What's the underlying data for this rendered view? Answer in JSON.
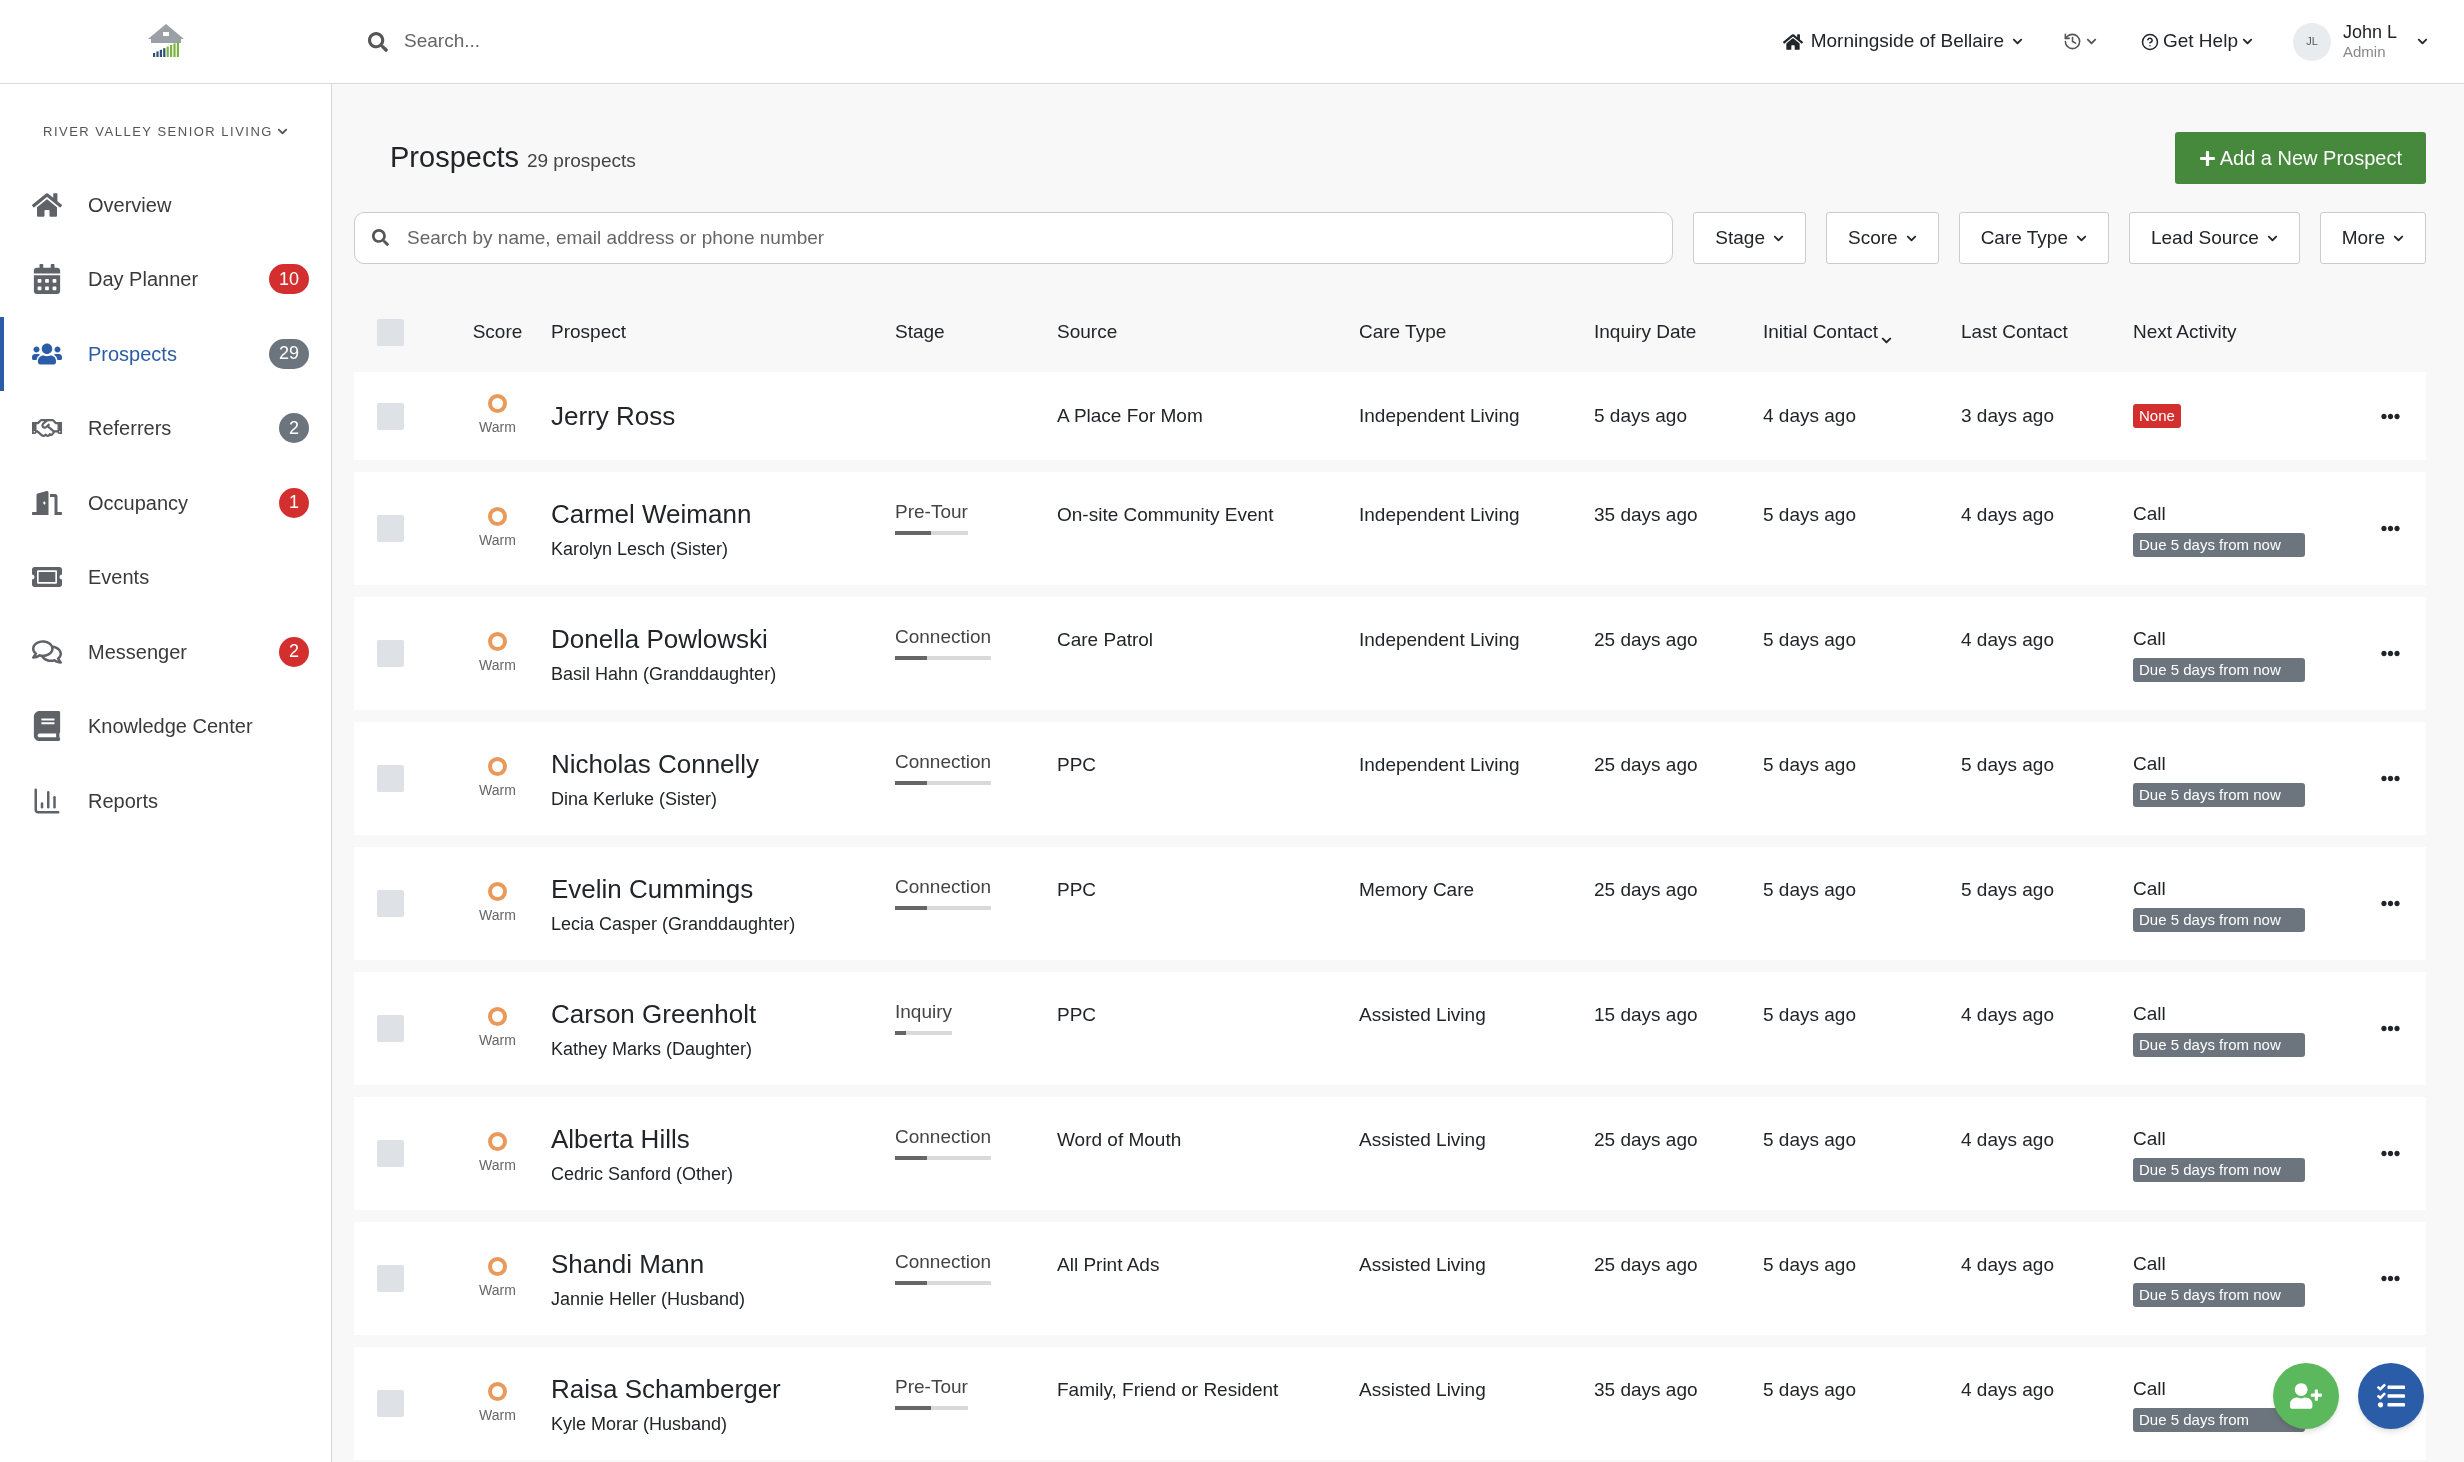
{
  "topbar": {
    "search_placeholder": "Search...",
    "community": "Morningside of Bellaire",
    "help": "Get Help",
    "user": {
      "initials": "JL",
      "name": "John L",
      "role": "Admin"
    }
  },
  "sidebar": {
    "org": "RIVER VALLEY SENIOR LIVING",
    "items": [
      {
        "label": "Overview",
        "selected": false
      },
      {
        "label": "Day Planner",
        "selected": false,
        "badge": "10",
        "color": "#d32f2f"
      },
      {
        "label": "Prospects",
        "selected": true,
        "badge": "29",
        "color": "#6c757d"
      },
      {
        "label": "Referrers",
        "selected": false,
        "badge": "2",
        "color": "#6c757d"
      },
      {
        "label": "Occupancy",
        "selected": false,
        "badge": "1",
        "color": "#d32f2f"
      },
      {
        "label": "Events",
        "selected": false
      },
      {
        "label": "Messenger",
        "selected": false,
        "badge": "2",
        "color": "#d32f2f"
      },
      {
        "label": "Knowledge Center",
        "selected": false
      },
      {
        "label": "Reports",
        "selected": false
      }
    ]
  },
  "page": {
    "title": "Prospects",
    "count": "29 prospects",
    "add_button": "Add a New Prospect",
    "search_placeholder": "Search by name, email address or phone number",
    "filters": [
      "Stage",
      "Score",
      "Care Type",
      "Lead Source",
      "More"
    ]
  },
  "table": {
    "select_all_checked": false,
    "columns": [
      {
        "label": "Score",
        "sorted": false
      },
      {
        "label": "Prospect",
        "sorted": false
      },
      {
        "label": "Stage",
        "sorted": false
      },
      {
        "label": "Source",
        "sorted": false
      },
      {
        "label": "Care Type",
        "sorted": false
      },
      {
        "label": "Inquiry Date",
        "sorted": false
      },
      {
        "label": "Initial Contact",
        "sorted": true
      },
      {
        "label": "Last Contact",
        "sorted": false
      },
      {
        "label": "Next Activity",
        "sorted": false
      }
    ],
    "rows": [
      {
        "checked": false,
        "score": "Warm",
        "name": "Jerry Ross",
        "source": "A Place For Mom",
        "care_type": "Independent Living",
        "inquiry": "5 days ago",
        "initial": "4 days ago",
        "last": "3 days ago",
        "next": {
          "kind": "none",
          "label": "None"
        }
      },
      {
        "checked": false,
        "score": "Warm",
        "name": "Carmel Weimann",
        "contact": "Karolyn Lesch (Sister)",
        "stage": {
          "label": "Pre-Tour",
          "level": 0.5
        },
        "source": "On-site Community Event",
        "care_type": "Independent Living",
        "inquiry": "35 days ago",
        "initial": "5 days ago",
        "last": "4 days ago",
        "next": {
          "kind": "task",
          "label": "Call",
          "due": "Due 5 days from now"
        }
      },
      {
        "checked": false,
        "score": "Warm",
        "name": "Donella Powlowski",
        "contact": "Basil Hahn (Granddaughter)",
        "stage": {
          "label": "Connection",
          "level": 0.33
        },
        "source": "Care Patrol",
        "care_type": "Independent Living",
        "inquiry": "25 days ago",
        "initial": "5 days ago",
        "last": "4 days ago",
        "next": {
          "kind": "task",
          "label": "Call",
          "due": "Due 5 days from now"
        }
      },
      {
        "checked": false,
        "score": "Warm",
        "name": "Nicholas Connelly",
        "contact": "Dina Kerluke (Sister)",
        "stage": {
          "label": "Connection",
          "level": 0.33
        },
        "source": "PPC",
        "care_type": "Independent Living",
        "inquiry": "25 days ago",
        "initial": "5 days ago",
        "last": "5 days ago",
        "next": {
          "kind": "task",
          "label": "Call",
          "due": "Due 5 days from now"
        }
      },
      {
        "checked": false,
        "score": "Warm",
        "name": "Evelin Cummings",
        "contact": "Lecia Casper (Granddaughter)",
        "stage": {
          "label": "Connection",
          "level": 0.33
        },
        "source": "PPC",
        "care_type": "Memory Care",
        "inquiry": "25 days ago",
        "initial": "5 days ago",
        "last": "5 days ago",
        "next": {
          "kind": "task",
          "label": "Call",
          "due": "Due 5 days from now"
        }
      },
      {
        "checked": false,
        "score": "Warm",
        "name": "Carson Greenholt",
        "contact": "Kathey Marks (Daughter)",
        "stage": {
          "label": "Inquiry",
          "level": 0.2
        },
        "source": "PPC",
        "care_type": "Assisted Living",
        "inquiry": "15 days ago",
        "initial": "5 days ago",
        "last": "4 days ago",
        "next": {
          "kind": "task",
          "label": "Call",
          "due": "Due 5 days from now"
        }
      },
      {
        "checked": false,
        "score": "Warm",
        "name": "Alberta Hills",
        "contact": "Cedric Sanford (Other)",
        "stage": {
          "label": "Connection",
          "level": 0.33
        },
        "source": "Word of Mouth",
        "care_type": "Assisted Living",
        "inquiry": "25 days ago",
        "initial": "5 days ago",
        "last": "4 days ago",
        "next": {
          "kind": "task",
          "label": "Call",
          "due": "Due 5 days from now"
        }
      },
      {
        "checked": false,
        "score": "Warm",
        "name": "Shandi Mann",
        "contact": "Jannie Heller (Husband)",
        "stage": {
          "label": "Connection",
          "level": 0.33
        },
        "source": "All Print Ads",
        "care_type": "Assisted Living",
        "inquiry": "25 days ago",
        "initial": "5 days ago",
        "last": "4 days ago",
        "next": {
          "kind": "task",
          "label": "Call",
          "due": "Due 5 days from now"
        }
      },
      {
        "checked": false,
        "score": "Warm",
        "name": "Raisa Schamberger",
        "contact": "Kyle Morar (Husband)",
        "stage": {
          "label": "Pre-Tour",
          "level": 0.5
        },
        "source": "Family, Friend or Resident",
        "care_type": "Assisted Living",
        "inquiry": "35 days ago",
        "initial": "5 days ago",
        "last": "4 days ago",
        "next": {
          "kind": "task",
          "label": "Call",
          "due": "Due 5 days from"
        }
      }
    ]
  }
}
